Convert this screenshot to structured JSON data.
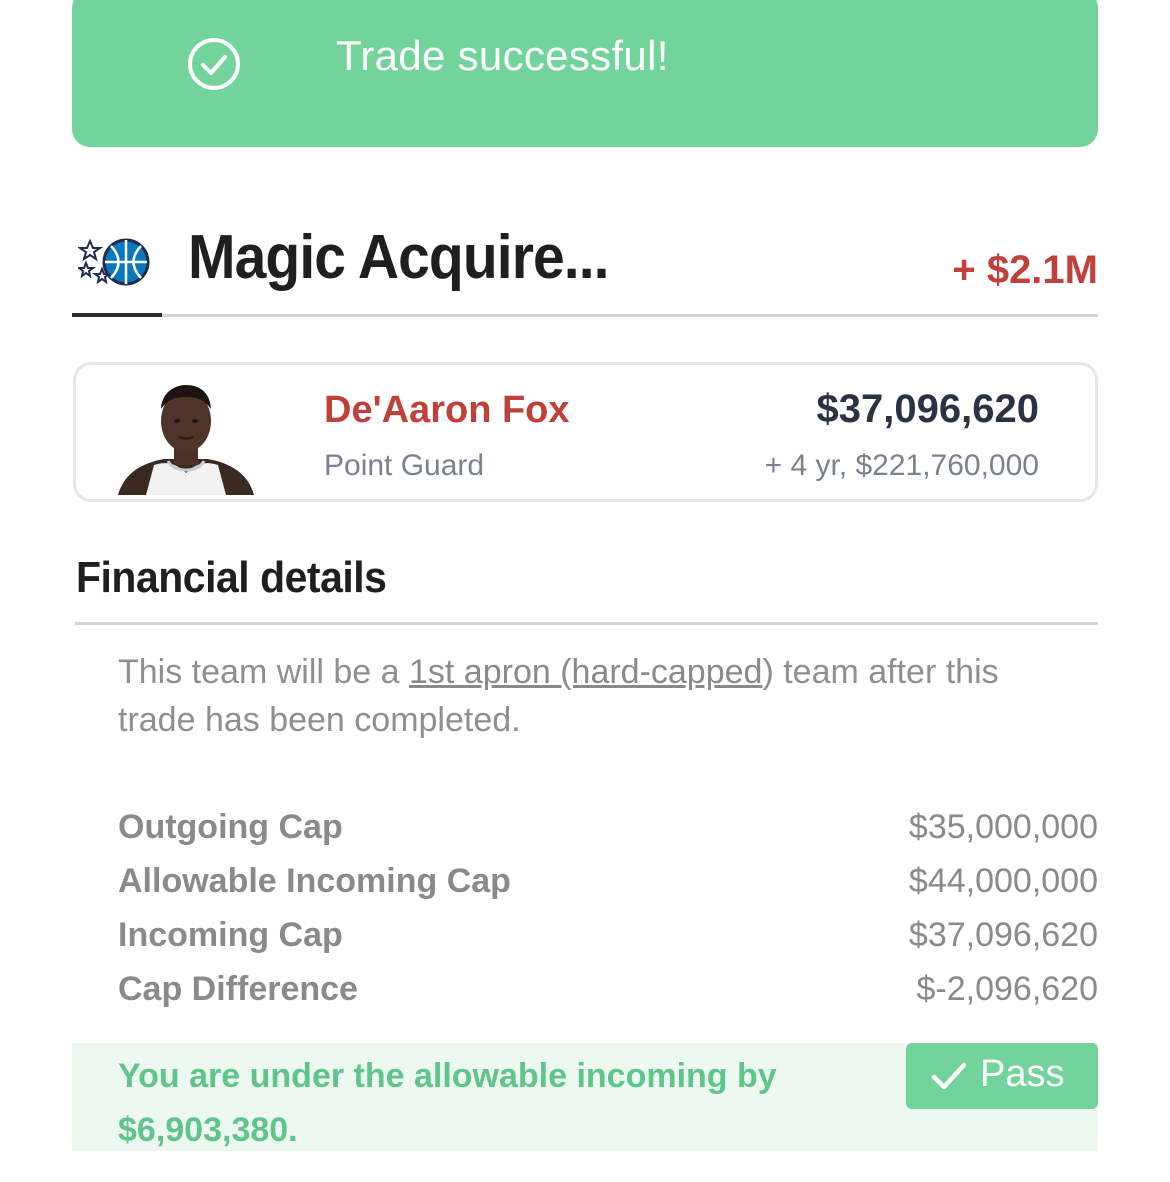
{
  "toast": {
    "message": "Trade successful!",
    "icon": "check-circle-icon",
    "color": "#72d39b"
  },
  "team": {
    "title": "Magic Acquire...",
    "cap_change": "+ $2.1M",
    "logo": "orlando-magic-logo"
  },
  "player": {
    "name": "De'Aaron Fox",
    "position": "Point Guard",
    "salary": "$37,096,620",
    "contract": "+ 4 yr, $221,760,000"
  },
  "financial": {
    "title": "Financial details",
    "note_prefix": "This team will be a ",
    "note_link": "1st apron (hard-capped",
    "note_suffix": ") team after this trade has been completed.",
    "rows": [
      {
        "label": "Outgoing Cap",
        "value": "$35,000,000"
      },
      {
        "label": "Allowable Incoming Cap",
        "value": "$44,000,000"
      },
      {
        "label": "Incoming Cap",
        "value": "$37,096,620"
      },
      {
        "label": "Cap Difference",
        "value": "$-2,096,620"
      }
    ]
  },
  "result": {
    "message": "You are under the allowable incoming by $6,903,380.",
    "status_label": "Pass",
    "status_color": "#72d39b"
  }
}
